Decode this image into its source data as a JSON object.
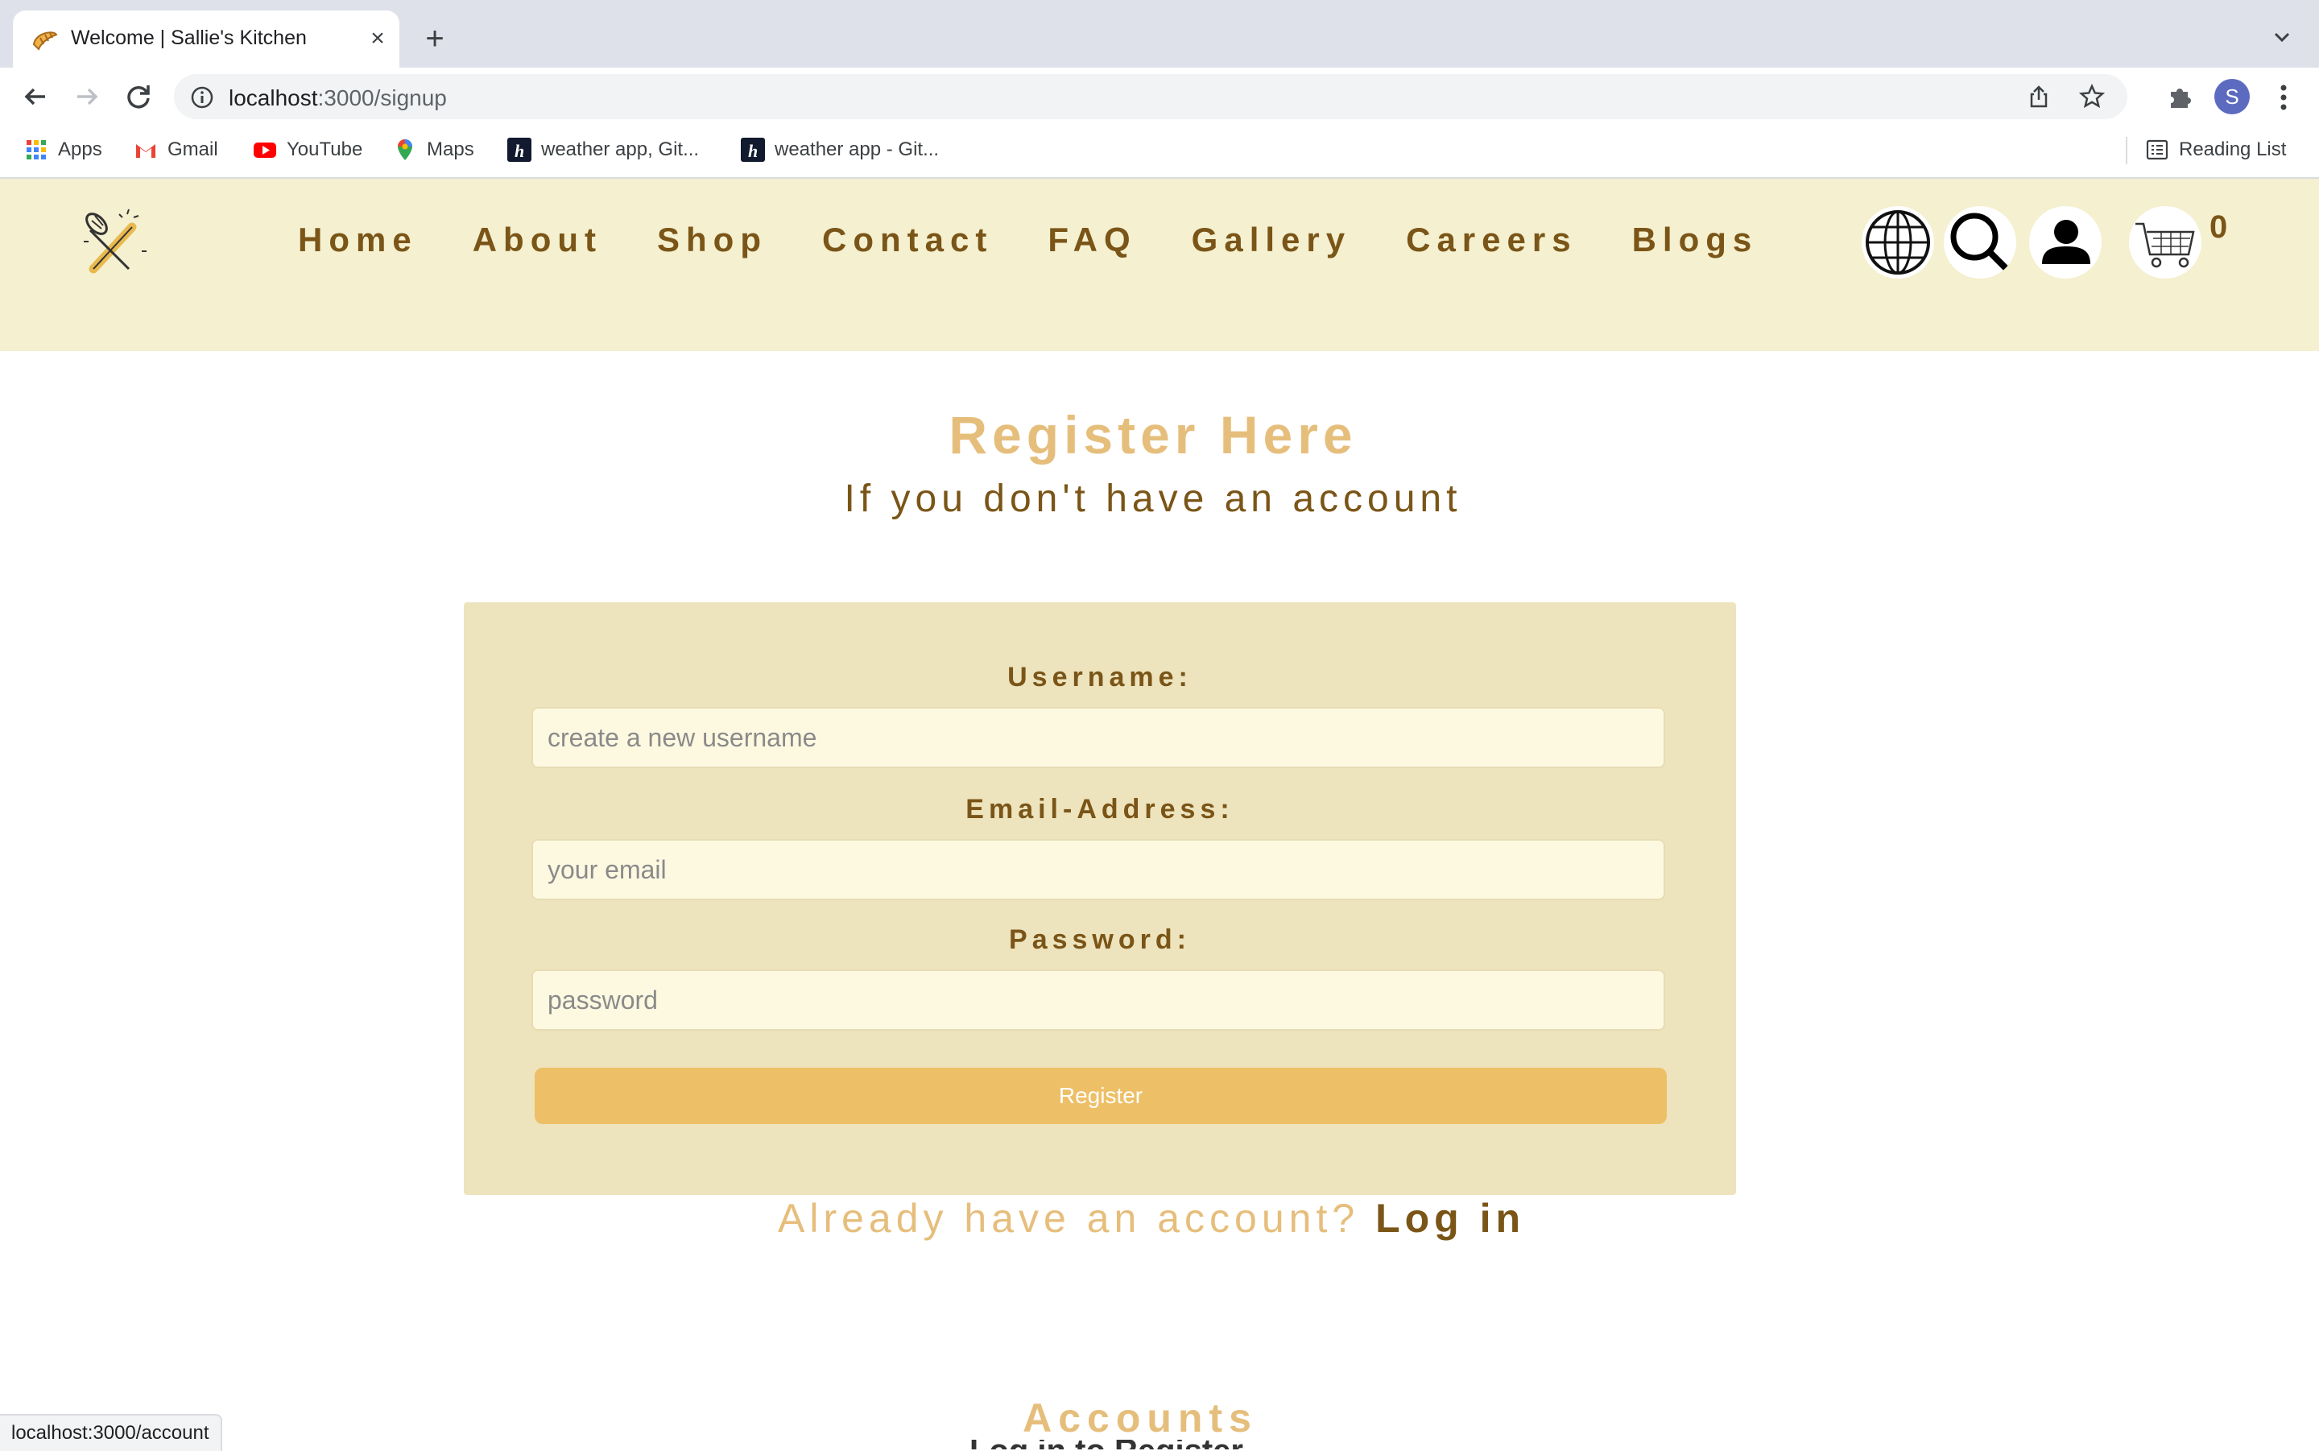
{
  "browser": {
    "tab_title": "Welcome | Sallie's Kitchen",
    "url_host": "localhost",
    "url_path": ":3000/signup",
    "profile_initial": "S",
    "bookmarks": [
      {
        "label": "Apps",
        "icon": "apps-grid-icon"
      },
      {
        "label": "Gmail",
        "icon": "gmail-icon"
      },
      {
        "label": "YouTube",
        "icon": "youtube-icon"
      },
      {
        "label": "Maps",
        "icon": "maps-icon"
      },
      {
        "label": "weather app, Git...",
        "icon": "h-icon"
      },
      {
        "label": "weather app - Git...",
        "icon": "h-icon"
      }
    ],
    "reading_list": "Reading List",
    "status_url": "localhost:3000/account"
  },
  "site": {
    "nav": [
      "Home",
      "About",
      "Shop",
      "Contact",
      "FAQ",
      "Gallery",
      "Careers",
      "Blogs"
    ],
    "cart_count": "0",
    "colors": {
      "header_bg": "#f4f0d0",
      "brown": "#7a5517",
      "gold": "#e6be7c",
      "button": "#edbf66"
    }
  },
  "register": {
    "title": "Register Here",
    "subtitle": "If you don't have an account",
    "username_label": "Username:",
    "username_placeholder": "create a new username",
    "email_label": "Email-Address:",
    "email_placeholder": "your email",
    "password_label": "Password:",
    "password_placeholder": "password",
    "button": "Register",
    "login_question": "Already have an account? ",
    "login_link": "Log in"
  },
  "accounts": {
    "title": "Accounts",
    "subtitle": "Log in to Register"
  }
}
